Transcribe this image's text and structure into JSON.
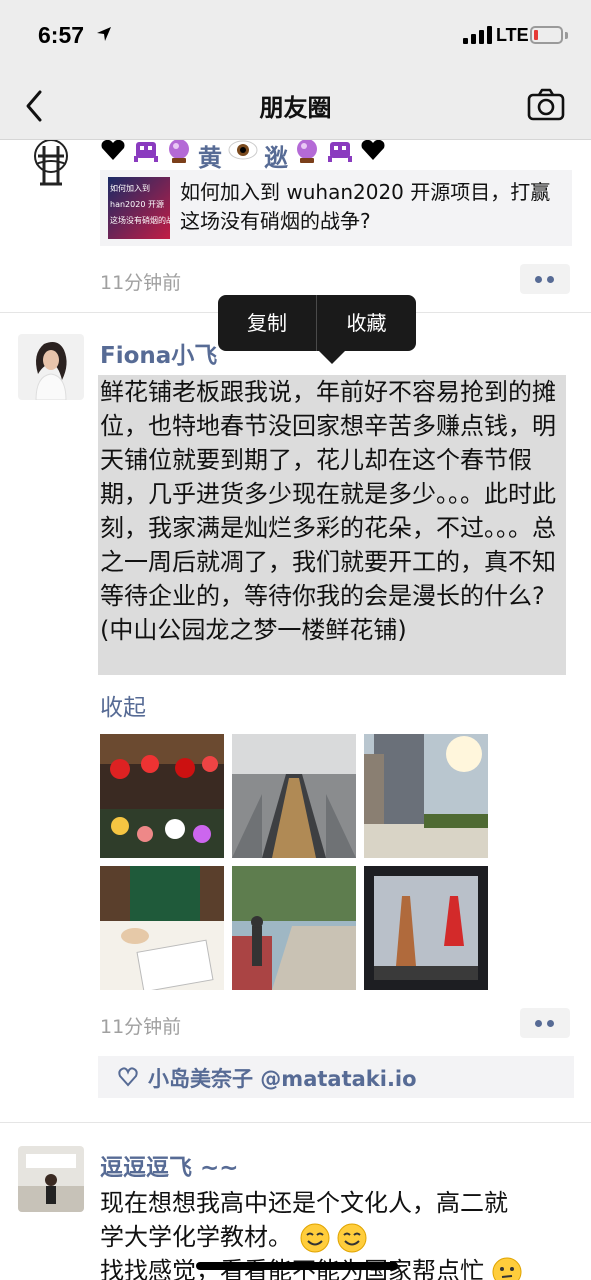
{
  "status_bar": {
    "time": "6:57",
    "network": "LTE"
  },
  "nav": {
    "title": "朋友圈",
    "back_icon": "chevron-left-icon",
    "camera_icon": "camera-icon"
  },
  "post1": {
    "username_fragment": "黄",
    "username_fragment2": "逖",
    "link_title": "如何加入到 wuhan2020 开源项目，打赢这场没有硝烟的战争?",
    "thumb_lines": [
      "如何加入到",
      "han2020 开源",
      "这场没有硝烟的战"
    ],
    "time": "11分钟前"
  },
  "post2": {
    "name": "Fiona小飞",
    "text": "鲜花铺老板跟我说，年前好不容易抢到的摊位，也特地春节没回家想辛苦多赚点钱，明天铺位就要到期了，花儿却在这个春节假期，几乎进货多少现在就是多少。。。此时此刻，我家满是灿烂多彩的花朵，不过。。。总之一周后就凋了，我们就要开工的，真不知等待企业的，等待你我的会是漫长的什么? (中山公园龙之梦一楼鲜花铺)",
    "fold": "收起",
    "time": "11分钟前",
    "likes": "小岛美奈子 @matataki.io"
  },
  "popup": {
    "copy": "复制",
    "favorite": "收藏"
  },
  "post3": {
    "name": "逗逗逗飞 ~~",
    "line1": "现在想想我高中还是个文化人，高二就",
    "line2": "学大学化学教材。",
    "line3": "找找感觉，看看能不能为国家帮点忙"
  },
  "colors": {
    "link": "#576b95",
    "nav_bg": "#ededed",
    "highlight": "#dcdcdc"
  }
}
